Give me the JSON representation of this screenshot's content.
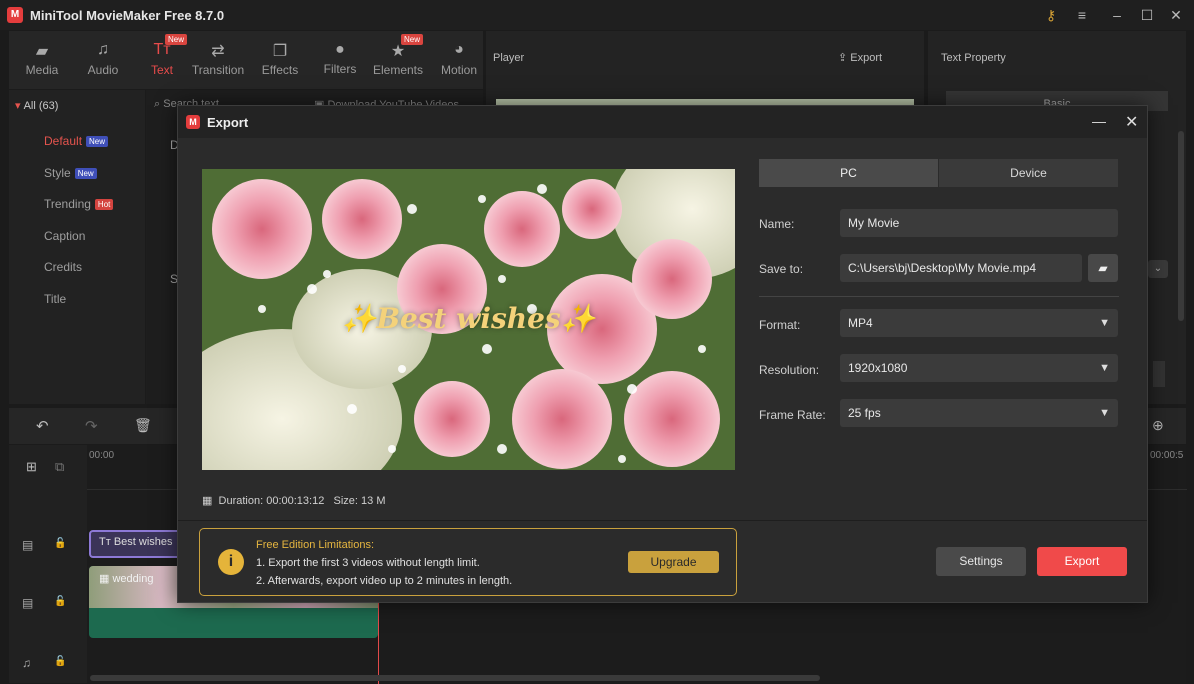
{
  "app": {
    "title": "MiniTool MovieMaker Free 8.7.0",
    "logo": "M"
  },
  "toolbar": {
    "items": [
      {
        "label": "Media",
        "icon": "folder-icon"
      },
      {
        "label": "Audio",
        "icon": "music-icon"
      },
      {
        "label": "Text",
        "icon": "text-icon",
        "badge": "New"
      },
      {
        "label": "Transition",
        "icon": "transition-icon"
      },
      {
        "label": "Effects",
        "icon": "effects-icon"
      },
      {
        "label": "Filters",
        "icon": "filters-icon"
      },
      {
        "label": "Elements",
        "icon": "elements-icon",
        "badge": "New"
      },
      {
        "label": "Motion",
        "icon": "motion-icon"
      }
    ]
  },
  "categories": {
    "all": "All (63)",
    "items": [
      "Default",
      "Style",
      "Trending",
      "Caption",
      "Credits",
      "Title"
    ],
    "badges": {
      "default": "New",
      "style": "New",
      "trending": "Hot"
    }
  },
  "content": {
    "search": "Search text",
    "download": "Download YouTube Videos",
    "letter_d": "D",
    "letter_s": "S"
  },
  "player": {
    "title": "Player",
    "export": "Export"
  },
  "property": {
    "title": "Text Property",
    "tab": "Basic"
  },
  "timeline": {
    "time_start": "00:00",
    "time_end": "00:00:5",
    "text_clip": "Best wishes",
    "video_clip": "wedding"
  },
  "dialog": {
    "title": "Export",
    "tabs": [
      "PC",
      "Device"
    ],
    "name_label": "Name:",
    "name_value": "My Movie",
    "save_label": "Save to:",
    "save_value": "C:\\Users\\bj\\Desktop\\My Movie.mp4",
    "format_label": "Format:",
    "format_value": "MP4",
    "resolution_label": "Resolution:",
    "resolution_value": "1920x1080",
    "framerate_label": "Frame Rate:",
    "framerate_value": "25 fps",
    "preview_text": "Best wishes",
    "duration": "Duration:  00:00:13:12",
    "size": "Size:  13 M",
    "limit_title": "Free Edition Limitations:",
    "limit_line1": "1. Export the first 3 videos without length limit.",
    "limit_line2": "2. Afterwards, export video up to 2 minutes in length.",
    "upgrade": "Upgrade",
    "settings": "Settings",
    "export": "Export"
  },
  "colors": {
    "accent": "#f04a4a",
    "gold": "#c9a13d"
  }
}
